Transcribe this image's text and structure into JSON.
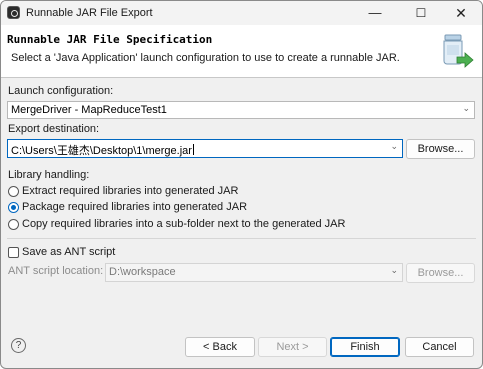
{
  "window": {
    "title": "Runnable JAR File Export",
    "icon": "eclipse-app-icon",
    "controls": {
      "minimize": "—",
      "maximize": "☐",
      "close": "✕"
    }
  },
  "banner": {
    "title": "Runnable JAR File Specification",
    "message": "Select a 'Java Application' launch configuration to use to create a runnable JAR.",
    "icon": "jar-export-icon"
  },
  "launch": {
    "label": "Launch configuration:",
    "value": "MergeDriver - MapReduceTest1"
  },
  "export": {
    "label": "Export destination:",
    "value": "C:\\Users\\王雄杰\\Desktop\\1\\merge.jar",
    "browse": "Browse..."
  },
  "library": {
    "label": "Library handling:",
    "options": [
      {
        "label": "Extract required libraries into generated JAR",
        "checked": false
      },
      {
        "label": "Package required libraries into generated JAR",
        "checked": true
      },
      {
        "label": "Copy required libraries into a sub-folder next to the generated JAR",
        "checked": false
      }
    ]
  },
  "ant": {
    "checkbox_label": "Save as ANT script",
    "checked": false,
    "location_label": "ANT script location:",
    "location_value": "D:\\workspace",
    "browse": "Browse..."
  },
  "footer": {
    "help": "?",
    "back": "< Back",
    "next": "Next >",
    "finish": "Finish",
    "cancel": "Cancel"
  },
  "colors": {
    "accent": "#0067c0",
    "window_bg": "#f0f0f0",
    "banner_bg": "#ffffff"
  }
}
